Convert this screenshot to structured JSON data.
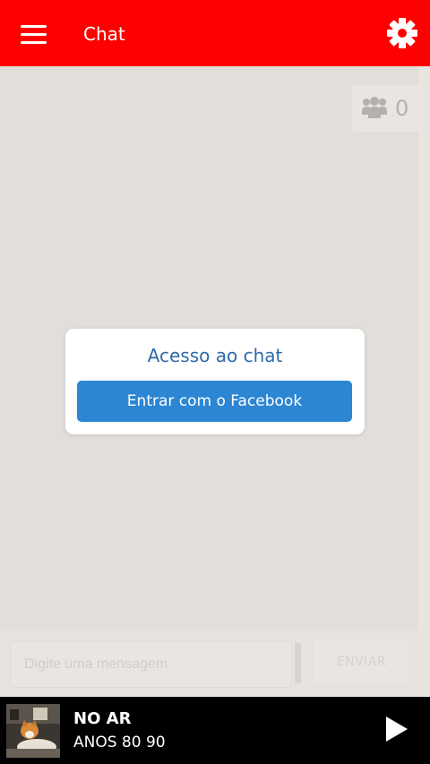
{
  "header": {
    "title": "Chat",
    "menu_icon": "hamburger-menu-icon",
    "settings_icon": "gear-icon",
    "bar_color": "#ff0000"
  },
  "users": {
    "icon": "users-group-icon",
    "count": "0"
  },
  "login": {
    "title": "Acesso ao chat",
    "facebook_button": "Entrar com o Facebook",
    "button_color": "#2c86d3"
  },
  "composer": {
    "placeholder": "Digite uma mensagem",
    "send_label": "ENVIAR"
  },
  "player": {
    "label": "NO AR",
    "program": "ANOS 80 90",
    "play_icon": "play-icon"
  }
}
